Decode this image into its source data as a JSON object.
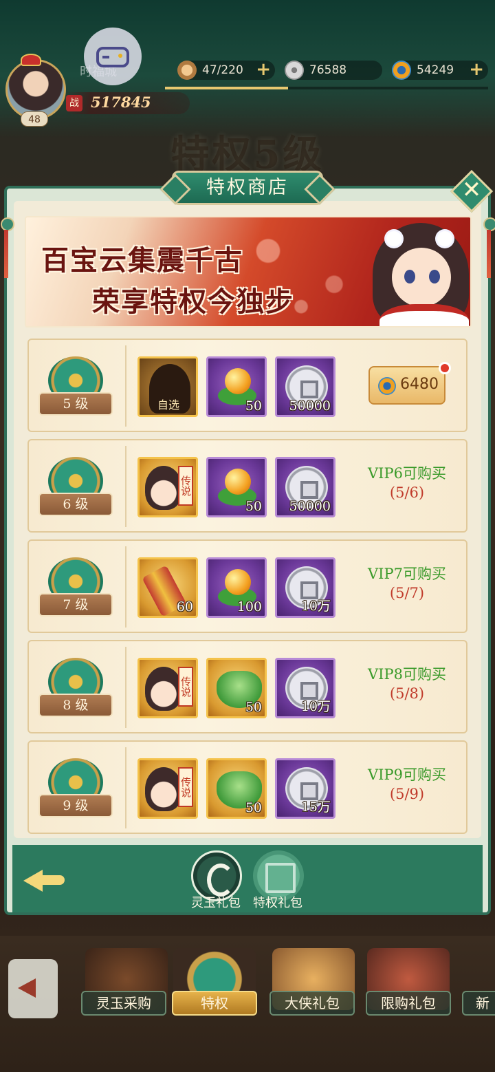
{
  "hud": {
    "city_label": "时福城",
    "player_level": "48",
    "power_icon": "战",
    "power": "517845",
    "stamina": "47/220",
    "coins": "76588",
    "jade": "54249",
    "plus": "+",
    "progress": 0.38
  },
  "background_title": "特权5级",
  "modal": {
    "title": "特权商店",
    "close": "✕",
    "banner": {
      "line1": "百宝云集震千古",
      "line2": "荣享特权今独步"
    }
  },
  "tiers": [
    {
      "level": "5 级",
      "items": [
        {
          "type": "hero-choice",
          "tag": "自选",
          "qty": ""
        },
        {
          "type": "orb",
          "qty": "50"
        },
        {
          "type": "coin",
          "qty": "50000"
        }
      ],
      "price": "6480"
    },
    {
      "level": "6 级",
      "items": [
        {
          "type": "hero",
          "tag": "传说",
          "qty": ""
        },
        {
          "type": "orb",
          "qty": "50"
        },
        {
          "type": "coin",
          "qty": "50000"
        }
      ],
      "vip": "VIP6可购买",
      "count": "(5/6)"
    },
    {
      "level": "7 级",
      "items": [
        {
          "type": "scroll",
          "qty": "60"
        },
        {
          "type": "orb",
          "qty": "100"
        },
        {
          "type": "coin",
          "qty": "10万"
        }
      ],
      "vip": "VIP7可购买",
      "count": "(5/7)"
    },
    {
      "level": "8 级",
      "items": [
        {
          "type": "hero",
          "tag": "传说",
          "qty": ""
        },
        {
          "type": "dumpling",
          "qty": "50"
        },
        {
          "type": "coin",
          "qty": "10万"
        }
      ],
      "vip": "VIP8可购买",
      "count": "(5/8)"
    },
    {
      "level": "9 级",
      "items": [
        {
          "type": "hero",
          "tag": "传说",
          "qty": ""
        },
        {
          "type": "dumpling",
          "qty": "50"
        },
        {
          "type": "coin",
          "qty": "15万"
        }
      ],
      "vip": "VIP9可购买",
      "count": "(5/9)"
    }
  ],
  "modal_tabs": {
    "jade_gift": "灵玉礼包",
    "privilege_gift": "特权礼包"
  },
  "nav": {
    "items": [
      "灵玉采购",
      "特权",
      "大侠礼包",
      "限购礼包",
      "新"
    ]
  },
  "colors": {
    "modal_green": "#2f6e58",
    "vip_green": "#3a9a2a",
    "count_red": "#c03a2a",
    "card_bg": "#f7ead0"
  }
}
